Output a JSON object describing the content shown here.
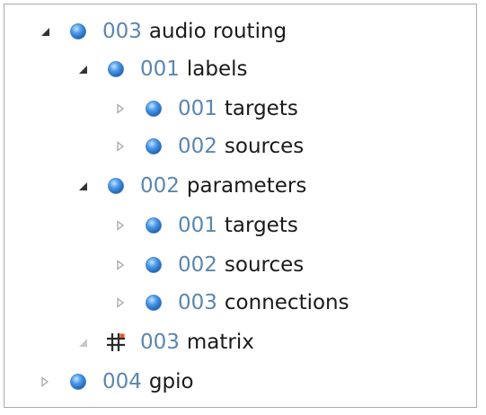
{
  "tree": {
    "nodes": [
      {
        "number": "003",
        "label": "audio routing",
        "expander": "expanded",
        "icon": "blue-sphere-icon"
      },
      {
        "number": "001",
        "label": "labels",
        "expander": "expanded",
        "icon": "blue-sphere-icon"
      },
      {
        "number": "001",
        "label": "targets",
        "expander": "collapsed",
        "icon": "blue-sphere-icon"
      },
      {
        "number": "002",
        "label": "sources",
        "expander": "collapsed",
        "icon": "blue-sphere-icon"
      },
      {
        "number": "002",
        "label": "parameters",
        "expander": "expanded",
        "icon": "blue-sphere-icon"
      },
      {
        "number": "001",
        "label": "targets",
        "expander": "collapsed",
        "icon": "blue-sphere-icon"
      },
      {
        "number": "002",
        "label": "sources",
        "expander": "collapsed",
        "icon": "blue-sphere-icon"
      },
      {
        "number": "003",
        "label": "connections",
        "expander": "collapsed",
        "icon": "blue-sphere-icon"
      },
      {
        "number": "003",
        "label": "matrix",
        "expander": "expanded-disabled",
        "icon": "matrix-grid-icon"
      },
      {
        "number": "004",
        "label": "gpio",
        "expander": "collapsed",
        "icon": "blue-sphere-icon"
      }
    ]
  },
  "colors": {
    "number_text": "#5b86b0",
    "label_text": "#1a1a1a",
    "expander_dark": "#333333",
    "expander_light": "#a6a6a6",
    "expander_disabled": "#c8c8c8",
    "sphere_light": "#c4e2ff",
    "sphere_mid": "#4a9ae8",
    "sphere_dark": "#1f5fae",
    "matrix_grid": "#2b2b2b",
    "matrix_accent": "#e8562a"
  }
}
